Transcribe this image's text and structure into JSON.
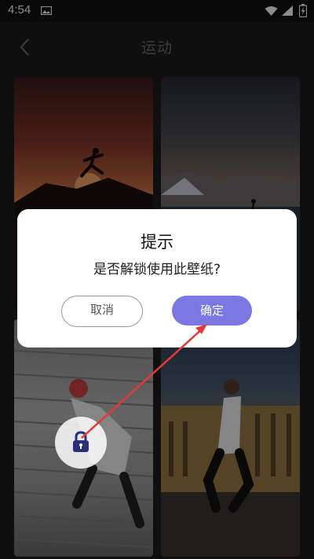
{
  "status_bar": {
    "time": "4:54",
    "icons": [
      "image-icon",
      "wifi-icon",
      "signal-icon",
      "battery-charging-icon"
    ]
  },
  "header": {
    "title": "运动",
    "back_icon": "chevron-left-icon"
  },
  "wallpapers": [
    {
      "description": "silhouette runner at sunset",
      "locked": false
    },
    {
      "description": "runner by mountain lake",
      "locked": false
    },
    {
      "description": "boxer on stairs",
      "locked": true
    },
    {
      "description": "runner in front of building",
      "locked": false
    }
  ],
  "dialog": {
    "title": "提示",
    "message": "是否解锁使用此壁纸?",
    "cancel_label": "取消",
    "confirm_label": "确定"
  },
  "colors": {
    "accent": "#7b78e4",
    "background": "#1c1c1e",
    "annotation_arrow": "#e53935"
  }
}
